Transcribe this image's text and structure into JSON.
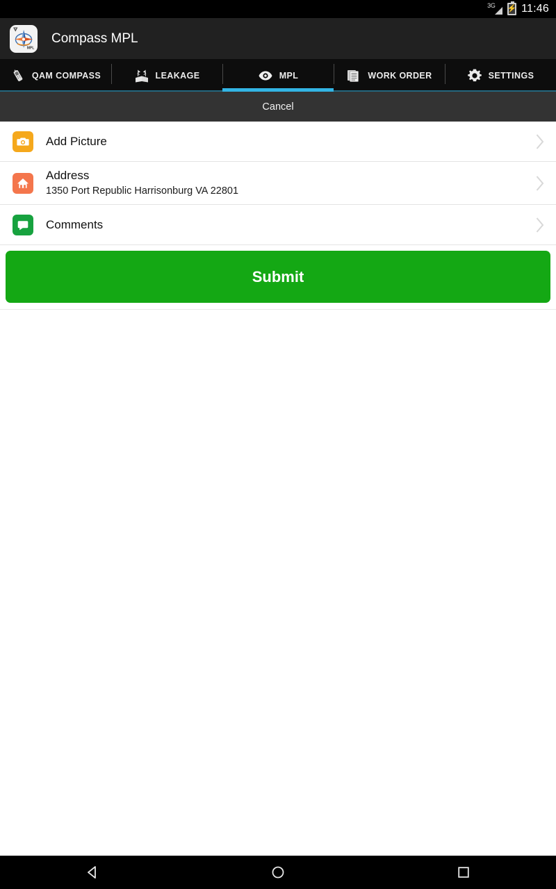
{
  "status_bar": {
    "network_label": "3G",
    "time": "11:46",
    "icons": [
      "signal-icon",
      "battery-charging-icon"
    ]
  },
  "action_bar": {
    "app_icon": "compass-mpl-app-icon",
    "title": "Compass MPL"
  },
  "tabs": [
    {
      "label": "QAM COMPASS",
      "icon": "signal-meter-icon",
      "active": false
    },
    {
      "label": "LEAKAGE",
      "icon": "leakage-flags-icon",
      "active": false
    },
    {
      "label": "MPL",
      "icon": "eye-icon",
      "active": true
    },
    {
      "label": "WORK ORDER",
      "icon": "documents-icon",
      "active": false
    },
    {
      "label": "SETTINGS",
      "icon": "gear-icon",
      "active": false
    }
  ],
  "cancel": {
    "label": "Cancel"
  },
  "list": {
    "rows": [
      {
        "title": "Add Picture",
        "subtitle": "",
        "icon": "camera-icon",
        "icon_color": "#f5a81c",
        "chevron": "chevron-right-icon"
      },
      {
        "title": "Address",
        "subtitle": "1350 Port Republic Harrisonburg VA 22801",
        "icon": "home-icon",
        "icon_color": "#f4764c",
        "chevron": "chevron-right-icon"
      },
      {
        "title": "Comments",
        "subtitle": "",
        "icon": "comment-bubble-icon",
        "icon_color": "#17a23f",
        "chevron": "chevron-right-icon"
      }
    ]
  },
  "submit": {
    "label": "Submit",
    "color": "#14a814"
  },
  "nav_bar": {
    "buttons": [
      {
        "name": "back-icon"
      },
      {
        "name": "home-icon"
      },
      {
        "name": "recents-icon"
      }
    ]
  },
  "theme": {
    "accent": "#33b5e5",
    "action_bar_bg": "#212121",
    "tab_bar_bg": "#0d0d0d",
    "cancel_bar_bg": "#333333"
  }
}
